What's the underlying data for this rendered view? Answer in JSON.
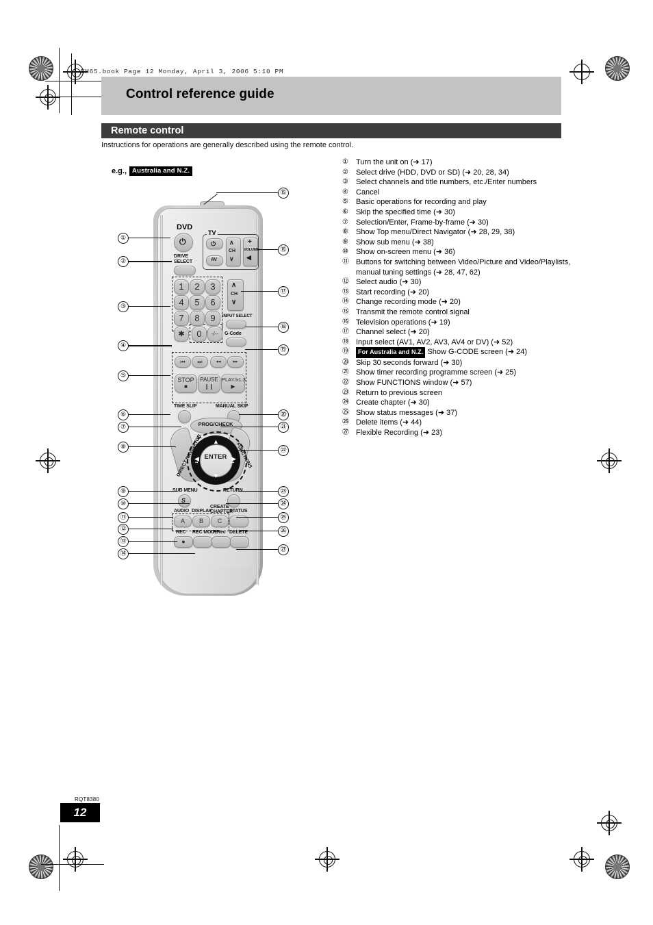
{
  "print_header": "EH65.book  Page 12  Monday, April 3, 2006  5:10 PM",
  "page_title": "Control reference guide",
  "section_title": "Remote control",
  "lead_text": "Instructions for operations are generally described using the remote control.",
  "example_label": "e.g.,",
  "example_badge": "Australia and N.Z.",
  "footer": {
    "doc_code": "RQT8380",
    "page_number": "12"
  },
  "legend": [
    {
      "num": "①",
      "text": "Turn the unit on (➜ 17)"
    },
    {
      "num": "②",
      "text": "Select drive (HDD, DVD or SD) (➜ 20, 28, 34)"
    },
    {
      "num": "③",
      "text": "Select channels and title numbers, etc./Enter numbers"
    },
    {
      "num": "④",
      "text": "Cancel"
    },
    {
      "num": "⑤",
      "text": "Basic operations for recording and play"
    },
    {
      "num": "⑥",
      "text": "Skip the specified time (➜ 30)"
    },
    {
      "num": "⑦",
      "text": "Selection/Enter, Frame-by-frame (➜ 30)"
    },
    {
      "num": "⑧",
      "text": "Show Top menu/Direct Navigator (➜ 28, 29, 38)"
    },
    {
      "num": "⑨",
      "text": "Show sub menu (➜ 38)"
    },
    {
      "num": "⑩",
      "text": "Show on-screen menu (➜ 36)"
    },
    {
      "num": "⑪",
      "text": "Buttons for switching between Video/Picture and Video/Playlists, manual tuning settings (➜ 28, 47, 62)"
    },
    {
      "num": "⑫",
      "text": "Select audio (➜ 30)"
    },
    {
      "num": "⑬",
      "text": "Start recording (➜ 20)"
    },
    {
      "num": "⑭",
      "text": "Change recording mode (➜ 20)"
    },
    {
      "num": "⑮",
      "text": "Transmit the remote control signal"
    },
    {
      "num": "⑯",
      "text": "Television operations (➜ 19)"
    },
    {
      "num": "⑰",
      "text": "Channel select (➜ 20)"
    },
    {
      "num": "⑱",
      "text": "Input select (AV1, AV2, AV3, AV4 or DV) (➜ 52)"
    },
    {
      "num": "⑲",
      "badge": "For Australia and N.Z.",
      "text": "Show G-CODE screen (➜ 24)"
    },
    {
      "num": "⑳",
      "text": "Skip 30 seconds forward (➜ 30)"
    },
    {
      "num": "㉑",
      "text": "Show timer recording programme screen (➜ 25)"
    },
    {
      "num": "㉒",
      "text": "Show FUNCTIONS window (➜ 57)"
    },
    {
      "num": "㉓",
      "text": "Return to previous screen"
    },
    {
      "num": "㉔",
      "text": "Create chapter (➜ 30)"
    },
    {
      "num": "㉕",
      "text": "Show status messages (➜ 37)"
    },
    {
      "num": "㉖",
      "text": "Delete items (➜ 44)"
    },
    {
      "num": "㉗",
      "text": "Flexible Recording (➜ 23)"
    }
  ],
  "remote": {
    "power_label": "DVD",
    "drive_select_label": "DRIVE\nSELECT",
    "drive_select_line1": "DRIVE",
    "drive_select_line2": "SELECT",
    "tv_group_label": "TV",
    "tv_av_label": "AV",
    "tv_ch_label": "CH",
    "tv_volume_label": "VOLUME",
    "tv_plus": "+",
    "tv_minus": "◂",
    "keypad": [
      "1",
      "2",
      "3",
      "4",
      "5",
      "6",
      "7",
      "8",
      "9"
    ],
    "key_star": "✱",
    "key_zero": "0",
    "key_dash": "-/--",
    "ch_label": "CH",
    "input_select_label": "INPUT SELECT",
    "gcode_label": "G-Code",
    "transport": {
      "skip_prev": "⏮",
      "skip_next": "⏭",
      "rew": "◂◂",
      "ff": "▸▸",
      "stop_label": "STOP",
      "stop_glyph": "■",
      "pause_label": "PAUSE",
      "pause_glyph": "❙❙",
      "play_label": "PLAY/x1.3",
      "play_glyph": "▶"
    },
    "time_slip_label": "TIME SLIP",
    "manual_skip_label": "MANUAL SKIP",
    "prog_check_label": "PROG/CHECK",
    "direct_navigator_label": "DIRECT NAVIGATOR",
    "functions_label": "FUNCTIONS",
    "enter_label": "ENTER",
    "sub_menu_label": "SUB MENU",
    "sub_menu_glyph": "S",
    "return_label": "RETURN",
    "audio_label": "AUDIO",
    "display_label": "DISPLAY",
    "create_chapter_l1": "CREATE",
    "create_chapter_l2": "CHAPTER",
    "status_label": "STATUS",
    "btn_a": "A",
    "btn_b": "B",
    "btn_c": "C",
    "rec_label": "REC",
    "rec_glyph": "●",
    "rec_mode_label": "REC MODE",
    "f_rec_label": "F Rec",
    "delete_label": "DELETE"
  },
  "callouts_left": [
    "①",
    "②",
    "③",
    "④",
    "⑤",
    "⑥",
    "⑦",
    "⑧",
    "⑨",
    "⑩",
    "⑪",
    "⑫",
    "⑬",
    "⑭"
  ],
  "callouts_right": [
    "⑮",
    "⑯",
    "⑰",
    "⑱",
    "⑲",
    "⑳",
    "㉑",
    "㉒",
    "㉓",
    "㉔",
    "㉕",
    "㉖",
    "㉗"
  ]
}
